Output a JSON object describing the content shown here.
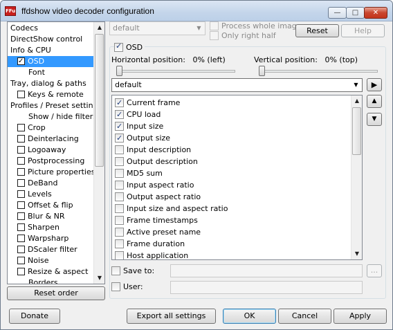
{
  "window": {
    "title": "ffdshow video decoder configuration",
    "app_icon_text": "FFu",
    "minimize_glyph": "—",
    "maximize_glyph": "□",
    "close_glyph": "✕"
  },
  "tree": {
    "items": [
      {
        "label": "Codecs",
        "checkbox": false,
        "checked": false,
        "selected": false
      },
      {
        "label": "DirectShow control",
        "checkbox": false,
        "checked": false,
        "selected": false
      },
      {
        "label": "Info & CPU",
        "checkbox": false,
        "checked": false,
        "selected": false
      },
      {
        "label": "OSD",
        "checkbox": true,
        "checked": true,
        "selected": true
      },
      {
        "label": "Font",
        "checkbox": false,
        "checked": false,
        "selected": false
      },
      {
        "label": "Tray, dialog & paths",
        "checkbox": false,
        "checked": false,
        "selected": false
      },
      {
        "label": "Keys & remote",
        "checkbox": true,
        "checked": false,
        "selected": false
      },
      {
        "label": "Profiles / Preset settings",
        "checkbox": false,
        "checked": false,
        "selected": false
      },
      {
        "label": "Show / hide filters",
        "checkbox": false,
        "checked": false,
        "selected": false
      },
      {
        "label": "Crop",
        "checkbox": true,
        "checked": false,
        "selected": false
      },
      {
        "label": "Deinterlacing",
        "checkbox": true,
        "checked": false,
        "selected": false
      },
      {
        "label": "Logoaway",
        "checkbox": true,
        "checked": false,
        "selected": false
      },
      {
        "label": "Postprocessing",
        "checkbox": true,
        "checked": false,
        "selected": false
      },
      {
        "label": "Picture properties",
        "checkbox": true,
        "checked": false,
        "selected": false
      },
      {
        "label": "DeBand",
        "checkbox": true,
        "checked": false,
        "selected": false
      },
      {
        "label": "Levels",
        "checkbox": true,
        "checked": false,
        "selected": false
      },
      {
        "label": "Offset & flip",
        "checkbox": true,
        "checked": false,
        "selected": false
      },
      {
        "label": "Blur & NR",
        "checkbox": true,
        "checked": false,
        "selected": false
      },
      {
        "label": "Sharpen",
        "checkbox": true,
        "checked": false,
        "selected": false
      },
      {
        "label": "Warpsharp",
        "checkbox": true,
        "checked": false,
        "selected": false
      },
      {
        "label": "DScaler filter",
        "checkbox": true,
        "checked": false,
        "selected": false
      },
      {
        "label": "Noise",
        "checkbox": true,
        "checked": false,
        "selected": false
      },
      {
        "label": "Resize & aspect",
        "checkbox": true,
        "checked": false,
        "selected": false
      },
      {
        "label": "Borders",
        "checkbox": false,
        "checked": false,
        "selected": false
      }
    ]
  },
  "reset_order_label": "Reset order",
  "top": {
    "preset_combo_value": "default",
    "process_whole_image_label": "Process whole image",
    "only_right_half_label": "Only right half",
    "reset_label": "Reset",
    "help_label": "Help"
  },
  "osd": {
    "enable_label": "OSD",
    "horizontal_label": "Horizontal position:",
    "horizontal_value": "0% (left)",
    "vertical_label": "Vertical position:",
    "vertical_value": "0% (top)",
    "horizontal_level": 0,
    "vertical_level": 0,
    "preset_value": "default",
    "play_glyph": "▶",
    "up_glyph": "▲",
    "down_glyph": "▼",
    "items": [
      {
        "label": "Current frame",
        "checked": true
      },
      {
        "label": "CPU load",
        "checked": true
      },
      {
        "label": "Input size",
        "checked": true
      },
      {
        "label": "Output size",
        "checked": true
      },
      {
        "label": "Input description",
        "checked": false
      },
      {
        "label": "Output description",
        "checked": false
      },
      {
        "label": "MD5 sum",
        "checked": false
      },
      {
        "label": "Input aspect ratio",
        "checked": false
      },
      {
        "label": "Output aspect ratio",
        "checked": false
      },
      {
        "label": "Input size and aspect ratio",
        "checked": false
      },
      {
        "label": "Frame timestamps",
        "checked": false
      },
      {
        "label": "Active preset name",
        "checked": false
      },
      {
        "label": "Frame duration",
        "checked": false
      },
      {
        "label": "Host application",
        "checked": false
      }
    ],
    "save_to_label": "Save to:",
    "browse_label": "...",
    "user_label": "User:"
  },
  "bottom": {
    "donate_label": "Donate",
    "export_label": "Export all settings",
    "ok_label": "OK",
    "cancel_label": "Cancel",
    "apply_label": "Apply"
  }
}
